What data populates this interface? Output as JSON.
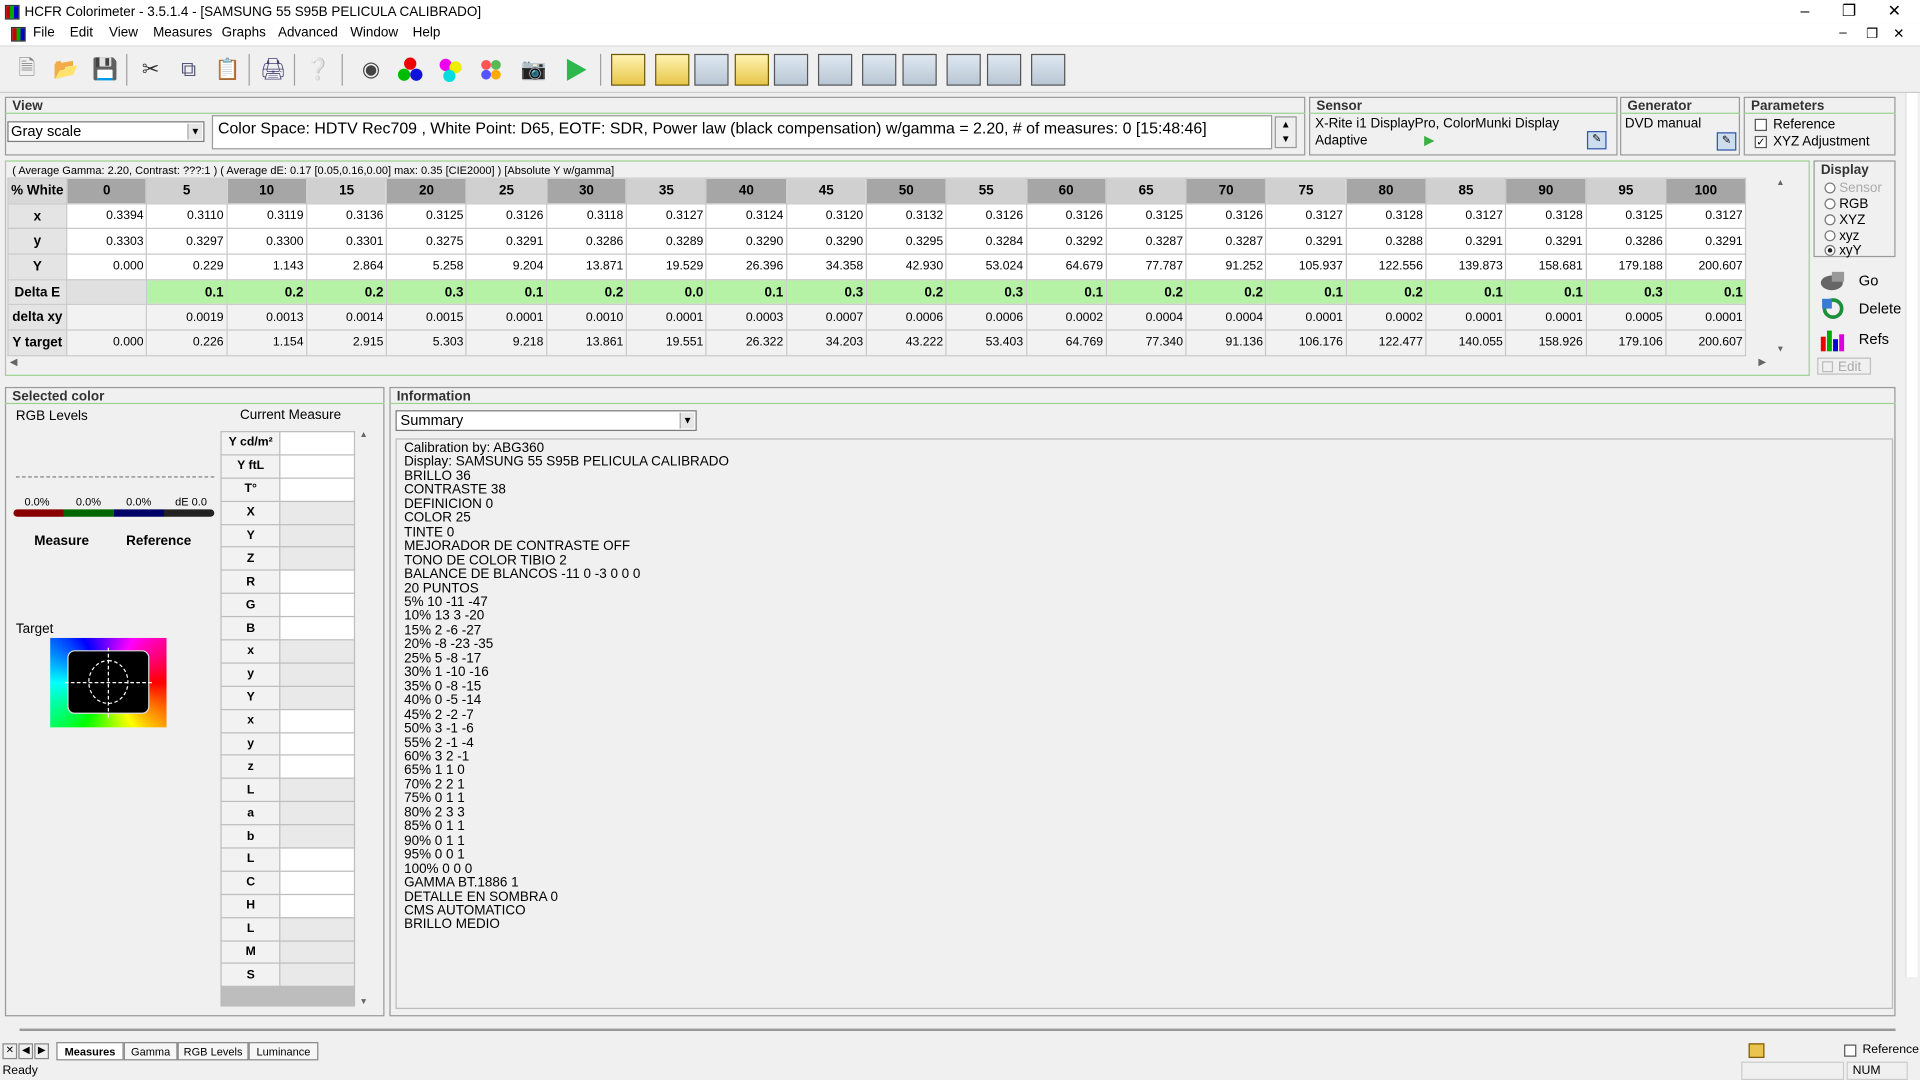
{
  "window": {
    "title": "HCFR Colorimeter - 3.5.1.4 - [SAMSUNG 55 S95B PELICULA CALIBRADO]"
  },
  "menu": [
    "File",
    "Edit",
    "View",
    "Measures",
    "Graphs",
    "Advanced",
    "Window",
    "Help"
  ],
  "view_panel": {
    "title": "View",
    "mode": "Gray scale",
    "colorspace_text": "Color Space: HDTV Rec709 , White Point: D65, EOTF:  SDR, Power law (black compensation) w/gamma = 2.20, # of measures: 0 [15:48:46]"
  },
  "sensor_panel": {
    "title": "Sensor",
    "line1": "X-Rite i1 DisplayPro, ColorMunki Display",
    "line2": "Adaptive"
  },
  "generator_panel": {
    "title": "Generator",
    "name": "DVD manual"
  },
  "parameters_panel": {
    "title": "Parameters",
    "reference": "Reference",
    "xyz_adjustment": "XYZ Adjustment"
  },
  "grid": {
    "info": "( Average Gamma: 2.20, Contrast: ???:1 )  ( Average dE: 0.17 [0.05,0.16,0.00] max: 0.35 [CIE2000] )  [Absolute Y w/gamma]",
    "header_label": "% White",
    "columns": [
      "0",
      "5",
      "10",
      "15",
      "20",
      "25",
      "30",
      "35",
      "40",
      "45",
      "50",
      "55",
      "60",
      "65",
      "70",
      "75",
      "80",
      "85",
      "90",
      "95",
      "100"
    ],
    "rows": [
      {
        "label": "x",
        "values": [
          "0.3394",
          "0.3110",
          "0.3119",
          "0.3136",
          "0.3125",
          "0.3126",
          "0.3118",
          "0.3127",
          "0.3124",
          "0.3120",
          "0.3132",
          "0.3126",
          "0.3126",
          "0.3125",
          "0.3126",
          "0.3127",
          "0.3128",
          "0.3127",
          "0.3128",
          "0.3125",
          "0.3127"
        ]
      },
      {
        "label": "y",
        "values": [
          "0.3303",
          "0.3297",
          "0.3300",
          "0.3301",
          "0.3275",
          "0.3291",
          "0.3286",
          "0.3289",
          "0.3290",
          "0.3290",
          "0.3295",
          "0.3284",
          "0.3292",
          "0.3287",
          "0.3287",
          "0.3291",
          "0.3288",
          "0.3291",
          "0.3291",
          "0.3286",
          "0.3291"
        ]
      },
      {
        "label": "Y",
        "values": [
          "0.000",
          "0.229",
          "1.143",
          "2.864",
          "5.258",
          "9.204",
          "13.871",
          "19.529",
          "26.396",
          "34.358",
          "42.930",
          "53.024",
          "64.679",
          "77.787",
          "91.252",
          "105.937",
          "122.556",
          "139.873",
          "158.681",
          "179.188",
          "200.607"
        ]
      },
      {
        "label": "Delta E",
        "values": [
          "",
          "0.1",
          "0.2",
          "0.2",
          "0.3",
          "0.1",
          "0.2",
          "0.0",
          "0.1",
          "0.3",
          "0.2",
          "0.3",
          "0.1",
          "0.2",
          "0.2",
          "0.1",
          "0.2",
          "0.1",
          "0.1",
          "0.3",
          "0.1"
        ]
      },
      {
        "label": "delta xy",
        "values": [
          "",
          "0.0019",
          "0.0013",
          "0.0014",
          "0.0015",
          "0.0001",
          "0.0010",
          "0.0001",
          "0.0003",
          "0.0007",
          "0.0006",
          "0.0006",
          "0.0002",
          "0.0004",
          "0.0004",
          "0.0001",
          "0.0002",
          "0.0001",
          "0.0001",
          "0.0005",
          "0.0001"
        ]
      },
      {
        "label": "Y target",
        "values": [
          "0.000",
          "0.226",
          "1.154",
          "2.915",
          "5.303",
          "9.218",
          "13.861",
          "19.551",
          "26.322",
          "34.203",
          "43.222",
          "53.403",
          "64.769",
          "77.340",
          "91.136",
          "106.176",
          "122.477",
          "140.055",
          "158.926",
          "179.106",
          "200.607"
        ]
      }
    ]
  },
  "display_panel": {
    "title": "Display",
    "options": [
      "Sensor",
      "RGB",
      "XYZ",
      "xyz",
      "xyY"
    ],
    "selected": "xyY",
    "buttons": {
      "go": "Go",
      "delete": "Delete",
      "refs": "Refs",
      "edit": "Edit"
    }
  },
  "selected_color": {
    "title": "Selected color",
    "rgb_levels": "RGB Levels",
    "current_measure": "Current Measure",
    "pct_r": "0.0%",
    "pct_g": "0.0%",
    "pct_b": "0.0%",
    "de": "dE 0.0",
    "measure": "Measure",
    "reference": "Reference",
    "target": "Target",
    "labels": [
      "Y cd/m²",
      "Y ftL",
      "T°",
      "X",
      "Y",
      "Z",
      "R",
      "G",
      "B",
      "x",
      "y",
      "Y",
      "x",
      "y",
      "z",
      "L",
      "a",
      "b",
      "L",
      "C",
      "H",
      "L",
      "M",
      "S"
    ]
  },
  "information": {
    "title": "Information",
    "dropdown": "Summary",
    "lines": [
      "Calibration by: ABG360",
      "Display: SAMSUNG 55 S95B PELICULA CALIBRADO",
      "BRILLO 36",
      "CONTRASTE 38",
      "DEFINICION 0",
      "COLOR 25",
      "TINTE 0",
      "MEJORADOR DE CONTRASTE OFF",
      "TONO DE COLOR TIBIO 2",
      "BALANCE DE BLANCOS -11 0 -3 0 0 0",
      "20 PUNTOS",
      "5% 10 -11 -47",
      "10% 13 3 -20",
      "15% 2 -6 -27",
      "20% -8 -23 -35",
      "25% 5 -8 -17",
      "30% 1 -10 -16",
      "35% 0 -8 -15",
      "40% 0 -5 -14",
      "45% 2 -2 -7",
      "50% 3 -1 -6",
      "55% 2 -1 -4",
      "60% 3 2 -1",
      "65% 1 1 0",
      "70% 2 2 1",
      "75% 0 1 1",
      "80% 2 3 3",
      "85% 0 1 1",
      "90% 0 1 1",
      "95% 0 0 1",
      "100% 0 0 0",
      "GAMMA BT.1886 1",
      "DETALLE EN SOMBRA 0",
      "CMS AUTOMATICO",
      "BRILLO MEDIO"
    ]
  },
  "tabs": [
    "Measures",
    "Gamma",
    "RGB Levels",
    "Luminance"
  ],
  "tab_active": "Measures",
  "bottom_reference": "Reference",
  "status": {
    "text": "Ready",
    "num": "NUM"
  }
}
